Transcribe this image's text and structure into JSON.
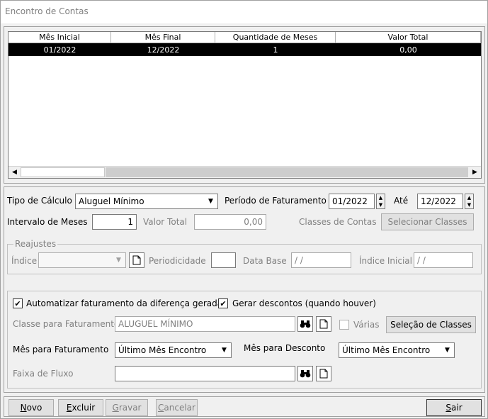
{
  "window": {
    "title": "Encontro de Contas"
  },
  "grid": {
    "columns": [
      "Mês Inicial",
      "Mês Final",
      "Quantidade de Meses",
      "Valor Total"
    ],
    "rows": [
      {
        "mes_inicial": "01/2022",
        "mes_final": "12/2022",
        "quantidade": "1",
        "valor_total": "0,00"
      }
    ]
  },
  "form": {
    "tipo_calculo_label": "Tipo de Cálculo",
    "tipo_calculo_value": "Aluguel Mínimo",
    "periodo_label": "Período de Faturamento",
    "periodo_inicio": "01/2022",
    "ate_label": "Até",
    "periodo_fim": "12/2022",
    "intervalo_label": "Intervalo de Meses",
    "intervalo_value": "1",
    "valor_total_label": "Valor Total",
    "valor_total_value": "0,00",
    "classes_label": "Classes de Contas",
    "selecionar_classes": "Selecionar Classes",
    "reajustes": {
      "legend": "Reajustes",
      "indice_label": "Índice",
      "indice_value": "",
      "periodicidade_label": "Periodicidade",
      "periodicidade_value": "",
      "data_base_label": "Data Base",
      "data_base_value": "/ /",
      "indice_inicial_label": "Índice Inicial",
      "indice_inicial_value": "/ /"
    },
    "automatizar_label": "Automatizar faturamento da diferença gerada",
    "gerar_descontos_label": "Gerar descontos (quando houver)",
    "classe_faturamento_label": "Classe para Faturamento",
    "classe_faturamento_value": "ALUGUEL MÍNIMO",
    "varias_label": "Várias",
    "selecao_classes": "Seleção de Classes",
    "mes_faturamento_label": "Mês para Faturamento",
    "mes_faturamento_value": "Último Mês Encontro",
    "mes_desconto_label": "Mês para Desconto",
    "mes_desconto_value": "Último Mês Encontro",
    "faixa_fluxo_label": "Faixa de Fluxo",
    "faixa_fluxo_value": ""
  },
  "footer": {
    "novo": {
      "first": "N",
      "rest": "ovo"
    },
    "excluir": {
      "first": "E",
      "rest": "xcluir"
    },
    "gravar": {
      "first": "G",
      "rest": "ravar"
    },
    "cancelar": {
      "first": "C",
      "rest": "ancelar"
    },
    "sair": {
      "first": "S",
      "rest": "air"
    }
  },
  "colors": {
    "selection": "#000000",
    "disabled_text": "#808080",
    "panel": "#f0f0f0"
  }
}
